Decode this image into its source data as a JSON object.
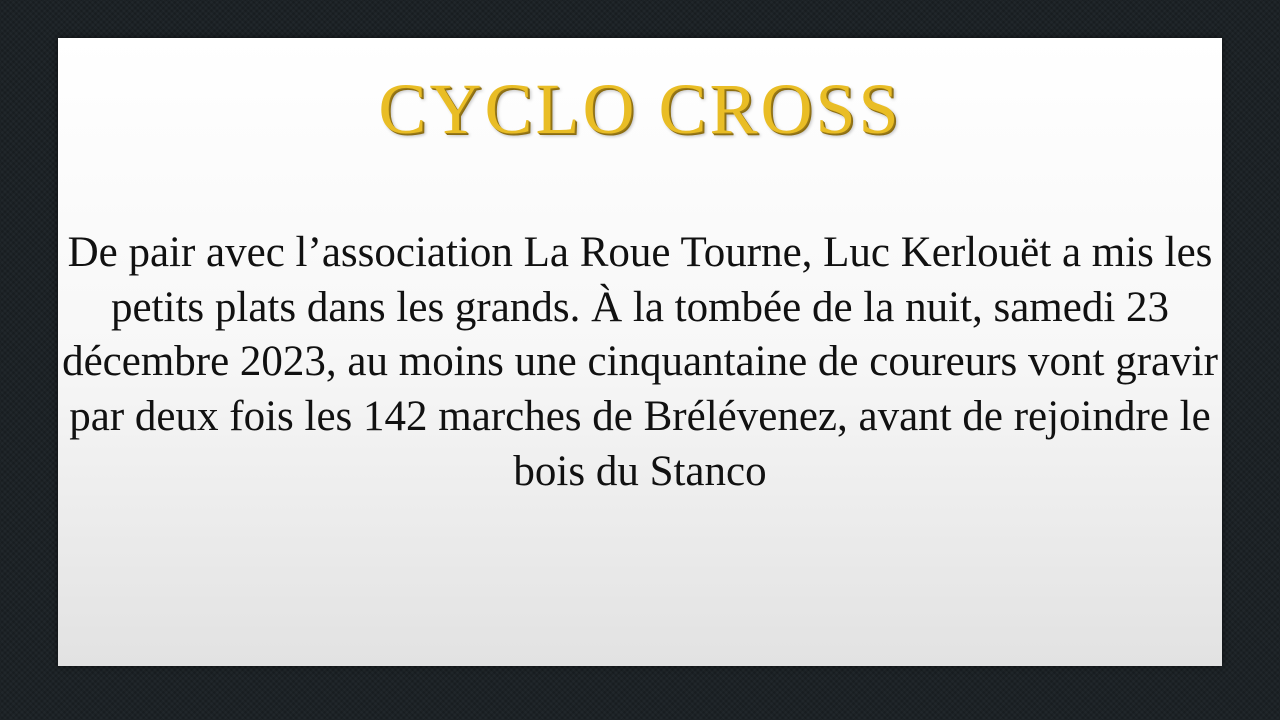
{
  "slide": {
    "title": "CYCLO CROSS",
    "body": "De pair avec l’association La Roue Tourne, Luc Kerlouët a mis les petits plats dans les grands. À la tombée de la nuit, samedi 23 décembre 2023, au moins une cinquantaine de coureurs vont gravir par deux fois les 142 marches de Brélévenez, avant de rejoindre le bois du Stanco",
    "title_color": "#e9bd25"
  }
}
